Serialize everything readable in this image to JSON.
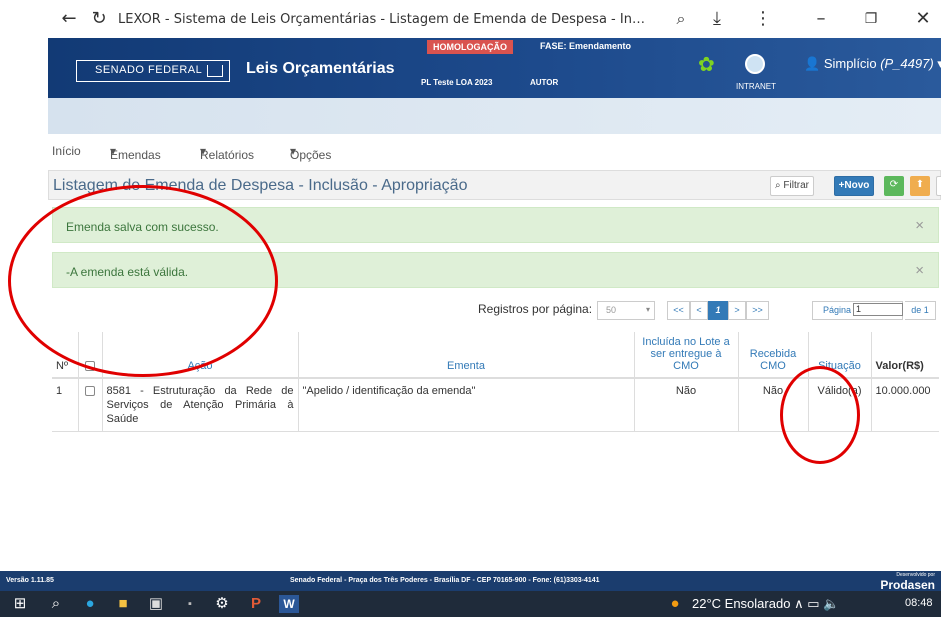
{
  "browser": {
    "title": "LEXOR - Sistema de Leis Orçamentárias - Listagem de Emenda de Despesa - Inclusã..."
  },
  "header": {
    "org": "SENADO FEDERAL",
    "app_title": "Leis Orçamentárias",
    "env_badge": "HOMOLOGAÇÃO",
    "fase": "FASE: Emendamento",
    "pl": "PL Teste LOA 2023",
    "autor": "AUTOR",
    "intranet": "INTRANET",
    "user_name": "Simplício",
    "user_id": "(P_4497)"
  },
  "nav": {
    "inicio": "Início",
    "emendas": "Emendas",
    "relatorios": "Relatórios",
    "opcoes": "Opções"
  },
  "panel": {
    "title": "Listagem de Emenda de Despesa - Inclusão - Apropriação",
    "filtrar": "Filtrar",
    "novo": "+Novo"
  },
  "alerts": [
    {
      "text": "Emenda salva com sucesso."
    },
    {
      "text": "-A emenda está válida."
    }
  ],
  "pagination": {
    "label": "Registros por página:",
    "per_page": "50",
    "first": "<<",
    "prev": "<",
    "current": "1",
    "next": ">",
    "last": ">>",
    "pagina_label": "Página",
    "pagina_value": "1",
    "de": "de 1"
  },
  "table": {
    "headers": {
      "num": "Nº",
      "acao": "Ação",
      "ementa": "Ementa",
      "incluida": "Incluída no Lote a ser entregue à CMO",
      "recebida": "Recebida CMO",
      "situacao": "Situação",
      "valor": "Valor(R$)"
    },
    "rows": [
      {
        "num": "1",
        "acao": "8581 - Estruturação da Rede de Serviços de Atenção Primária à Saúde",
        "ementa": "\"Apelido / identificação da emenda\"",
        "incluida": "Não",
        "recebida": "Não",
        "situacao": "Válido(a)",
        "valor": "10.000.000"
      }
    ]
  },
  "footer": {
    "version": "Versão 1.11.85",
    "address": "Senado Federal - Praça dos Três Poderes - Brasília DF - CEP 70165-900 - Fone: (61)3303-4141",
    "developed": "Desenvolvido por",
    "prodasen": "Prodasen"
  },
  "taskbar": {
    "weather": "22°C Ensolarado",
    "time": "08:48"
  },
  "colors": {
    "header_blue": "#1d4a8c",
    "alert_green_bg": "#dff0d8",
    "alert_green_text": "#3c763d",
    "annotation_red": "#e00000",
    "link_blue": "#337ab7"
  }
}
